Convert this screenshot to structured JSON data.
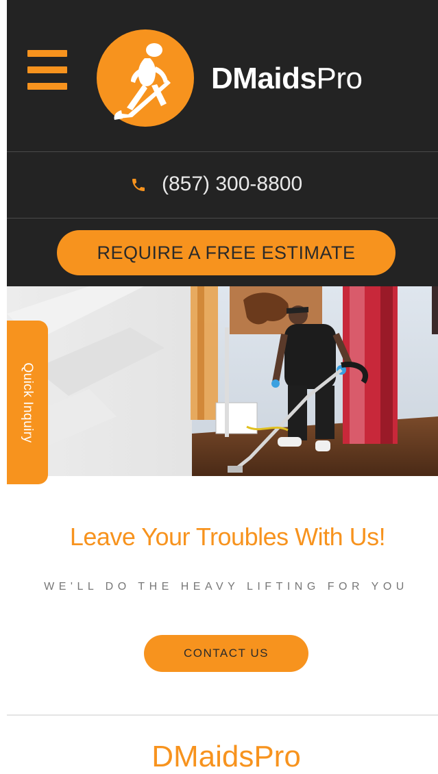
{
  "brand": {
    "name_bold": "DMaids",
    "name_light": "Pro",
    "accent_color": "#f7931e",
    "header_bg": "#232323"
  },
  "header": {
    "menu_icon": "hamburger-menu-icon",
    "logo_icon": "cleaner-vacuum-logo-icon"
  },
  "contact": {
    "phone_icon": "phone-icon",
    "phone": "(857) 300-8800"
  },
  "cta": {
    "estimate_label": "REQUIRE A FREE ESTIMATE"
  },
  "sidebar": {
    "quick_inquiry_label": "Quick Inquiry"
  },
  "hero": {
    "image_subject": "cleaner vacuuming hardwood floor"
  },
  "main": {
    "headline": "Leave Your Troubles With Us!",
    "subheadline": "WE'LL DO THE HEAVY LIFTING FOR YOU",
    "contact_label": "CONTACT US"
  },
  "footer": {
    "title": "DMaidsPro"
  }
}
